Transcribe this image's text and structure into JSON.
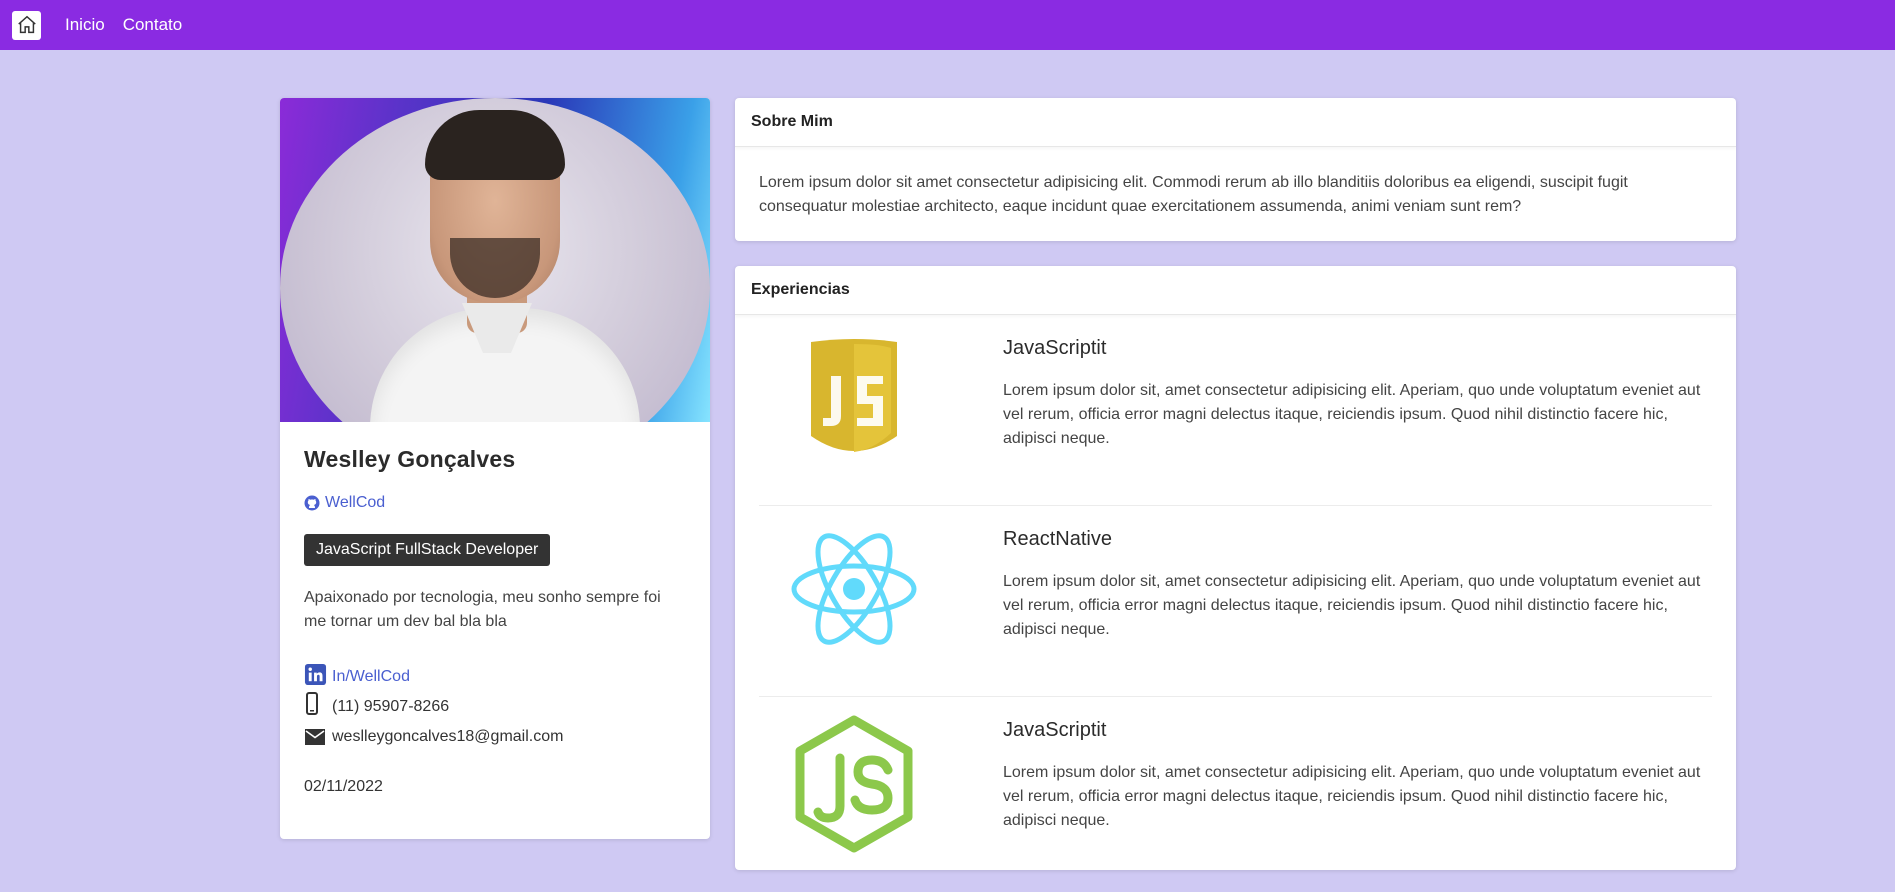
{
  "nav": {
    "home_icon": "home-icon",
    "links": [
      "Inicio",
      "Contato"
    ]
  },
  "profile": {
    "name": "Weslley Gonçalves",
    "github_label": "WellCod",
    "role": "JavaScript FullStack Developer",
    "bio": "Apaixonado por tecnologia, meu sonho sempre foi me tornar um dev bal bla bla",
    "linkedin_label": "In/WellCod",
    "phone": "(11) 95907-8266",
    "email": "weslleygoncalves18@gmail.com",
    "date": "02/11/2022"
  },
  "about": {
    "title": "Sobre Mim",
    "text": "Lorem ipsum dolor sit amet consectetur adipisicing elit. Commodi rerum ab illo blanditiis doloribus ea eligendi, suscipit fugit consequatur molestiae architecto, eaque incidunt quae exercitationem assumenda, animi veniam sunt rem?"
  },
  "experiences": {
    "title": "Experiencias",
    "items": [
      {
        "title": "JavaScriptit",
        "logo": "javascript-logo",
        "description": "Lorem ipsum dolor sit, amet consectetur adipisicing elit. Aperiam, quo unde voluptatum eveniet aut vel rerum, officia error magni delectus itaque, reiciendis ipsum. Quod nihil distinctio facere hic, adipisci neque."
      },
      {
        "title": "ReactNative",
        "logo": "react-logo",
        "description": "Lorem ipsum dolor sit, amet consectetur adipisicing elit. Aperiam, quo unde voluptatum eveniet aut vel rerum, officia error magni delectus itaque, reiciendis ipsum. Quod nihil distinctio facere hic, adipisci neque."
      },
      {
        "title": "JavaScriptit",
        "logo": "nodejs-logo",
        "description": "Lorem ipsum dolor sit, amet consectetur adipisicing elit. Aperiam, quo unde voluptatum eveniet aut vel rerum, officia error magni delectus itaque, reiciendis ipsum. Quod nihil distinctio facere hic, adipisci neque."
      }
    ]
  },
  "colors": {
    "navbar": "#8a2be2",
    "background": "#cfc9f3",
    "link": "#4a5fd0",
    "js_yellow": "#d8b62e",
    "react_blue": "#61dafb",
    "node_green": "#8cc84b"
  }
}
